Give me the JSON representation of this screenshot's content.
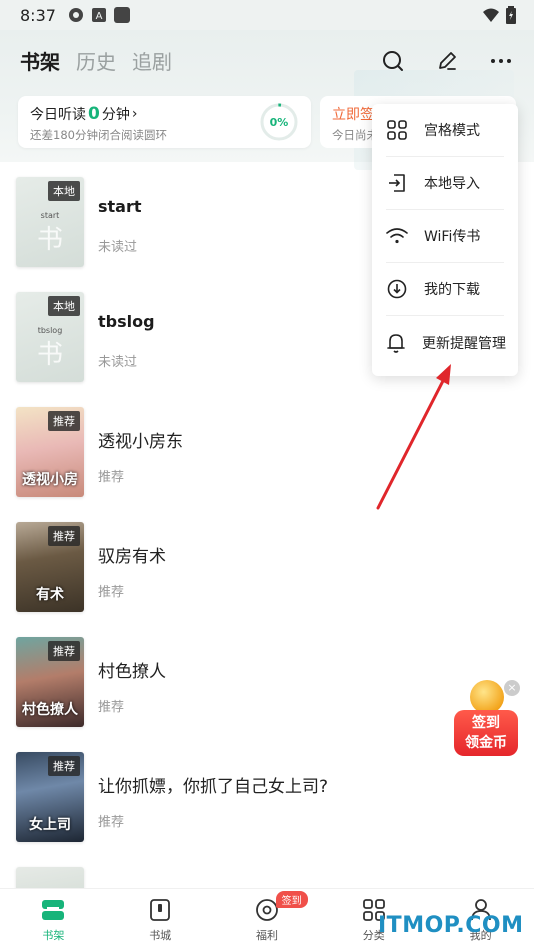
{
  "status_bar": {
    "time": "8:37"
  },
  "header": {
    "tabs": [
      {
        "label": "书架",
        "active": true
      },
      {
        "label": "历史",
        "active": false
      },
      {
        "label": "追剧",
        "active": false
      }
    ],
    "icons": [
      "search-icon",
      "edit-icon",
      "more-icon"
    ]
  },
  "listen_card": {
    "prefix": "今日听读",
    "minutes": "0",
    "suffix": "分钟",
    "chevron": "›",
    "subtitle": "还差180分钟闭合阅读圆环",
    "progress_label": "0%",
    "progress_fraction": 0
  },
  "sign_card": {
    "title": "立即签",
    "subtitle": "今日尚未"
  },
  "books": [
    {
      "cover_style": "local",
      "cover_text": "start",
      "tag": "本地",
      "title": "start",
      "status": "未读过",
      "latin": true
    },
    {
      "cover_style": "local",
      "cover_text": "tbslog",
      "tag": "本地",
      "title": "tbslog",
      "status": "未读过",
      "latin": true
    },
    {
      "cover_style": "c1",
      "cover_text": "透视小房",
      "tag": "推荐",
      "title": "透视小房东",
      "status": "推荐",
      "latin": false
    },
    {
      "cover_style": "c2",
      "cover_text": "有术",
      "tag": "推荐",
      "title": "驭房有术",
      "status": "推荐",
      "latin": false
    },
    {
      "cover_style": "c3",
      "cover_text": "村色撩人",
      "tag": "推荐",
      "title": "村色撩人",
      "status": "推荐",
      "latin": false
    },
    {
      "cover_style": "c4",
      "cover_text": "女上司",
      "tag": "推荐",
      "title": "让你抓嫖，你抓了自己女上司?",
      "status": "推荐",
      "latin": false
    }
  ],
  "dropdown": {
    "items": [
      {
        "label": "宫格模式",
        "icon": "grid-icon"
      },
      {
        "label": "本地导入",
        "icon": "import-icon"
      },
      {
        "label": "WiFi传书",
        "icon": "wifi-icon"
      },
      {
        "label": "我的下载",
        "icon": "download-icon"
      },
      {
        "label": "更新提醒管理",
        "icon": "bell-icon"
      }
    ]
  },
  "float_badge": {
    "line1": "签到",
    "line2": "领金币",
    "close": "×"
  },
  "bottom_nav": {
    "items": [
      {
        "label": "书架",
        "icon": "bookshelf-icon",
        "active": true
      },
      {
        "label": "书城",
        "icon": "bookstore-icon",
        "active": false
      },
      {
        "label": "福利",
        "icon": "welfare-icon",
        "active": false,
        "badge": "签到"
      },
      {
        "label": "分类",
        "icon": "category-icon",
        "active": false
      },
      {
        "label": "我的",
        "icon": "profile-icon",
        "active": false
      }
    ]
  },
  "watermark": "ITMOP.COM",
  "colors": {
    "accent": "#17b47a",
    "arrow": "#e0262b",
    "sign": "#f06a3a"
  }
}
